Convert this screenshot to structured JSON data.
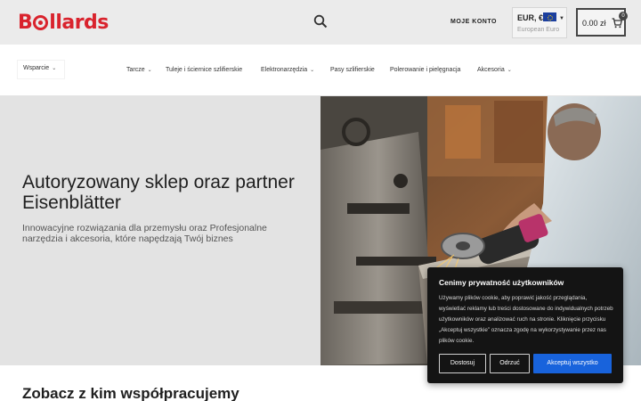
{
  "header": {
    "logo_text_1": "B",
    "logo_text_2": "llards",
    "account_label": "MOJE KONTO",
    "currency": {
      "code": "EUR, €",
      "name": "European Euro"
    },
    "cart": {
      "total": "0.00 zł",
      "count": "0"
    }
  },
  "nav": {
    "support_label": "Wsparcie",
    "items": [
      {
        "label": "Tarcze",
        "has_dropdown": true
      },
      {
        "label": "Tuleje i ściernice szlifierskie",
        "has_dropdown": false
      },
      {
        "label": "Elektronarzędzia",
        "has_dropdown": true
      },
      {
        "label": "Pasy szlifierskie",
        "has_dropdown": false
      },
      {
        "label": "Polerowanie i pielęgnacja",
        "has_dropdown": false
      },
      {
        "label": "Akcesoria",
        "has_dropdown": true
      }
    ]
  },
  "hero": {
    "title": "Autoryzowany sklep oraz partner Eisenblätter",
    "subtitle": "Innowacyjne rozwiązania dla przemysłu oraz Profesjonalne narzędzia i akcesoria, które napędzają Twój biznes"
  },
  "section": {
    "title": "Zobacz z kim współpracujemy"
  },
  "cookie": {
    "title": "Cenimy prywatność użytkowników",
    "text": "Używamy plików cookie, aby poprawić jakość przeglądania, wyświetlać reklamy lub treści dostosowane do indywidualnych potrzeb użytkowników oraz analizować ruch na stronie. Kliknięcie przycisku „Akceptuj wszystkie” oznacza zgodę na wykorzystywanie przez nas plików cookie.",
    "customize_label": "Dostosuj",
    "reject_label": "Odrzuć",
    "accept_label": "Akceptuj wszystko"
  },
  "colors": {
    "brand_red": "#d9232d",
    "header_bg": "#ebebeb",
    "hero_left_bg": "#e3e3e3",
    "cookie_bg": "#141414",
    "accept_blue": "#1863dc"
  },
  "icons": {
    "search": "search-icon",
    "cart": "cart-icon",
    "flag": "eu-flag-icon",
    "chevron": "chevron-down-icon"
  }
}
